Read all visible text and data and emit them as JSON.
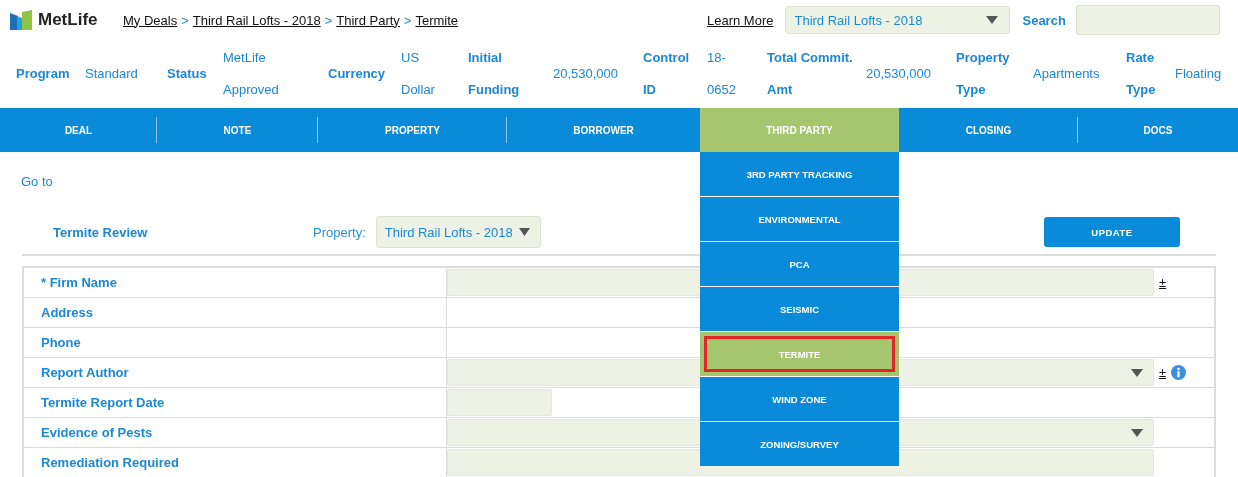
{
  "header": {
    "logo": "MetLife",
    "breadcrumbs": [
      "My Deals",
      "Third Rail Lofts - 2018",
      "Third Party",
      "Termite"
    ],
    "separator": ">",
    "learn_more": "Learn More",
    "deal_select": "Third Rail Lofts - 2018",
    "search_label": "Search"
  },
  "summary": [
    {
      "label": "Program",
      "value": "Standard"
    },
    {
      "label": "Status",
      "value": "MetLife Approved"
    },
    {
      "label": "Currency",
      "value": "US Dollar"
    },
    {
      "label": "Initial Funding",
      "value": "20,530,000"
    },
    {
      "label": "Control ID",
      "value": "18-0652"
    },
    {
      "label": "Total Commit. Amt",
      "value": "20,530,000"
    },
    {
      "label": "Property Type",
      "value": "Apartments"
    },
    {
      "label": "Rate Type",
      "value": "Floating"
    }
  ],
  "nav": [
    {
      "label": "DEAL",
      "selected": false
    },
    {
      "label": "NOTE",
      "selected": false
    },
    {
      "label": "PROPERTY",
      "selected": false
    },
    {
      "label": "BORROWER",
      "selected": false
    },
    {
      "label": "THIRD PARTY",
      "selected": true
    },
    {
      "label": "CLOSING",
      "selected": false
    },
    {
      "label": "DOCS",
      "selected": false
    }
  ],
  "submenu": [
    {
      "label": "3RD PARTY TRACKING",
      "selected": false
    },
    {
      "label": "ENVIRONMENTAL",
      "selected": false
    },
    {
      "label": "PCA",
      "selected": false
    },
    {
      "label": "SEISMIC",
      "selected": false
    },
    {
      "label": "TERMITE",
      "selected": true
    },
    {
      "label": "WIND ZONE",
      "selected": false
    },
    {
      "label": "ZONING/SURVEY",
      "selected": false
    }
  ],
  "goto": "Go to",
  "section": {
    "title": "Termite Review",
    "property_label": "Property:",
    "property_select": "Third Rail Lofts - 2018",
    "update_button": "UPDATE"
  },
  "form": [
    {
      "label": "* Firm Name",
      "kind": "input",
      "plus": "±"
    },
    {
      "label": "Address",
      "kind": "none"
    },
    {
      "label": "Phone",
      "kind": "none"
    },
    {
      "label": "Report Author",
      "kind": "select",
      "plus": "±",
      "info": true
    },
    {
      "label": "Termite Report Date",
      "kind": "date"
    },
    {
      "label": "Evidence of Pests",
      "kind": "select"
    },
    {
      "label": "Remediation Required",
      "kind": "input"
    }
  ]
}
